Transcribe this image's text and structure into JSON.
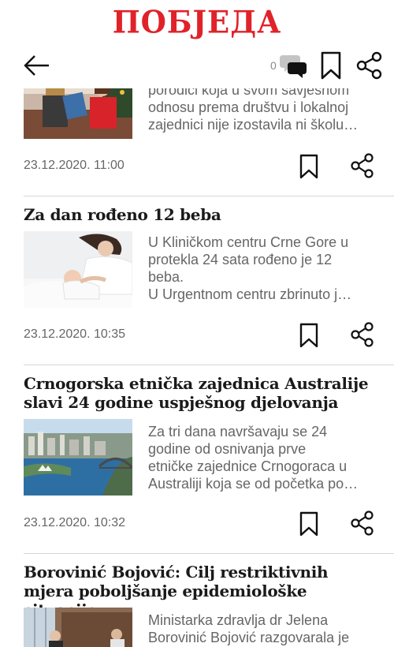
{
  "header": {
    "logo": "ПОБЈЕДА",
    "comment_count": "0",
    "icons": [
      "arrow-left-icon",
      "comments-icon",
      "bookmark-icon",
      "share-icon"
    ]
  },
  "articles": [
    {
      "title": "",
      "excerpt": "porodici koja u svom savjesnom\nodnosu prema društvu i lokalnoj\nzajednici nije izostavila ni školu…",
      "date": "23.12.2020. 11:00",
      "thumb": "two people holding a certificate"
    },
    {
      "title": "Za dan rođeno 12 beba",
      "excerpt": "U Kliničkom centru Crne Gore u\nprotekla 24 sata rođeno je 12\nbeba.\nU Urgentnom centru zbrinuto j…",
      "date": "23.12.2020. 10:35",
      "thumb": "mother with newborn baby"
    },
    {
      "title": "Crnogorska etnička zajednica Australije slavi 24 godine uspješnog djelovanja",
      "excerpt": "Za tri dana navršavaju se 24\ngodine od osnivanja prve\netničke zajednice Crnogoraca u\nAustraliji koja se od početka po…",
      "date": "23.12.2020. 10:32",
      "thumb": "Sydney harbour aerial view"
    },
    {
      "title": "Borovinić Bojović: Cilj restriktivnih mjera poboljšanje epidemiološke situacije",
      "excerpt": "Ministarka zdravlja dr Jelena\nBorovinić Bojović razgovarala je",
      "date": "",
      "thumb": "meeting in an office"
    }
  ],
  "colors": {
    "brand": "#e0222a",
    "text": "#1a1a1a",
    "muted": "#666666",
    "divider": "#d6d6d6"
  }
}
